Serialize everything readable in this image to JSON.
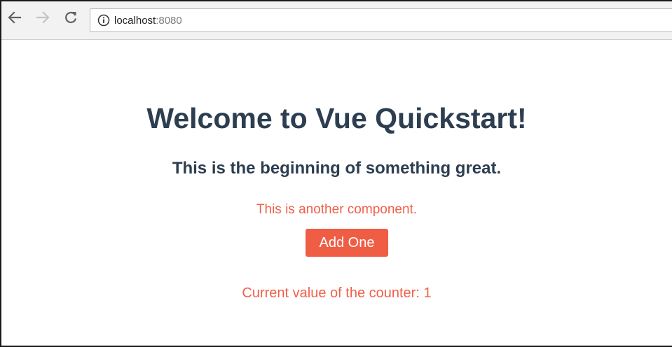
{
  "browser": {
    "url_host": "localhost",
    "url_port": ":8080",
    "icons": {
      "back": "arrow-left-icon",
      "forward": "arrow-right-icon",
      "reload": "reload-icon",
      "site_info": "info-icon"
    },
    "colors": {
      "toolbar_bg": "#f2f2f2",
      "icon_active": "#5f6368",
      "icon_disabled": "#c4c4c4"
    }
  },
  "page": {
    "title": "Welcome to Vue Quickstart!",
    "subtitle": "This is the beginning of something great.",
    "component_text": "This is another component.",
    "button_label": "Add One",
    "counter_text": "Current value of the counter: 1",
    "colors": {
      "heading": "#2c3e50",
      "accent": "#f0604a",
      "button_bg": "#ef5d45"
    }
  }
}
